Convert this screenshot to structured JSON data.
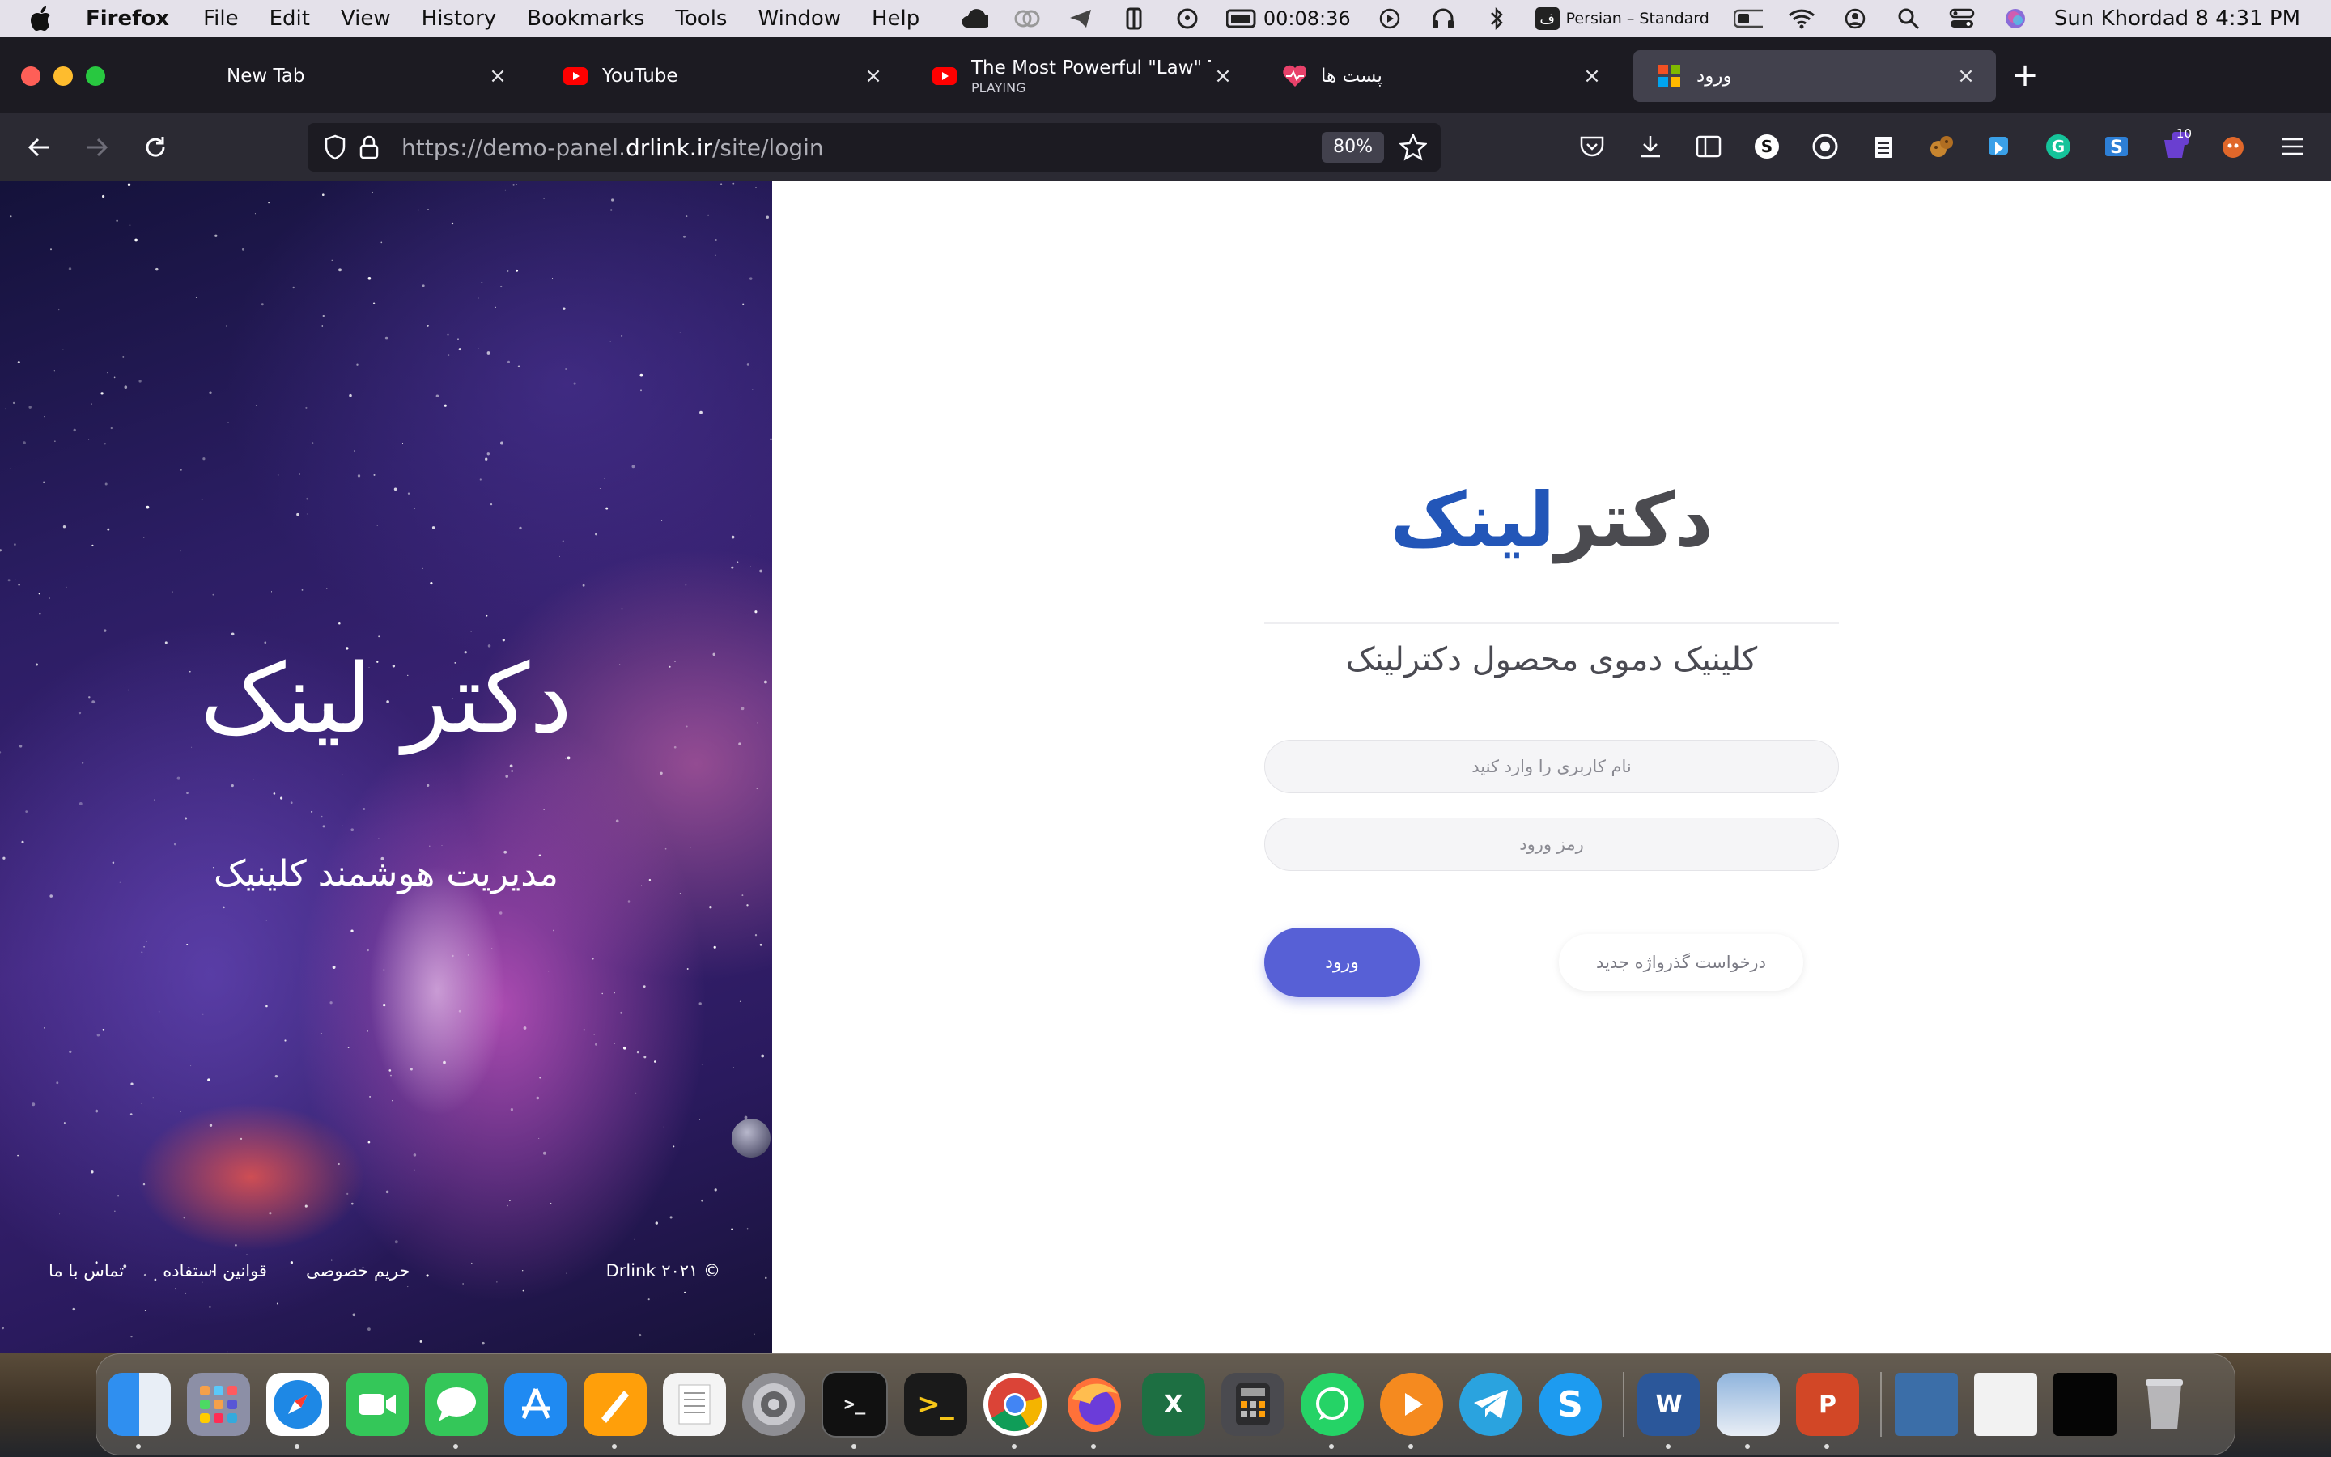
{
  "menubar": {
    "app_name": "Firefox",
    "items": [
      "File",
      "Edit",
      "View",
      "History",
      "Bookmarks",
      "Tools",
      "Window",
      "Help"
    ],
    "timer": "00:08:36",
    "input_source_badge": "ف",
    "input_source": "Persian – Standard",
    "datetime": "Sun Khordad 8  4:31 PM"
  },
  "browser": {
    "tabs": [
      {
        "title": "New Tab",
        "subtitle": "",
        "icon": "none"
      },
      {
        "title": "YouTube",
        "subtitle": "",
        "icon": "youtube-icon"
      },
      {
        "title": "The Most Powerful \"Law\" That C",
        "subtitle": "PLAYING",
        "icon": "youtube-icon"
      },
      {
        "title": "پست ها",
        "subtitle": "",
        "icon": "heart-pulse-icon"
      },
      {
        "title": "ورود",
        "subtitle": "",
        "icon": "grid-logo-icon"
      }
    ],
    "active_tab": 4,
    "url_prefix": "https://demo-panel.",
    "url_domain": "drlink.ir",
    "url_path": "/site/login",
    "zoom": "80%",
    "extension_badge": "10"
  },
  "hero": {
    "title": "دکتر لینک",
    "subtitle": "مدیریت هوشمند کلینیک",
    "copyright": "Drlink ۲۰۲۱ ©",
    "links": [
      "حریم خصوصی",
      "قوانین استفاده",
      "تماس با ما"
    ]
  },
  "login": {
    "logo_part1": "دکتر",
    "logo_part2": "لینک",
    "clinic_name": "کلینیک دموی محصول دکترلینک",
    "username_placeholder": "نام کاربری را وارد کنید",
    "password_placeholder": "رمز ورود",
    "login_button": "ورود",
    "forgot_button": "درخواست گذرواژه جدید"
  },
  "colors": {
    "primary_button": "#5760d6",
    "logo_dark": "#4b4b50",
    "logo_blue": "#2356b8",
    "browser_chrome": "#1c1b22"
  },
  "dock": {
    "apps": [
      "Finder",
      "Launchpad",
      "Safari",
      "FaceTime",
      "Messages",
      "App Store",
      "Pages",
      "TextEdit",
      "System Preferences",
      "Terminal",
      "PowerShell",
      "Chrome",
      "Firefox",
      "Excel",
      "Calculator",
      "WhatsApp",
      "Infuse",
      "Telegram",
      "Skype",
      "Word",
      "Preview",
      "PowerPoint"
    ]
  }
}
